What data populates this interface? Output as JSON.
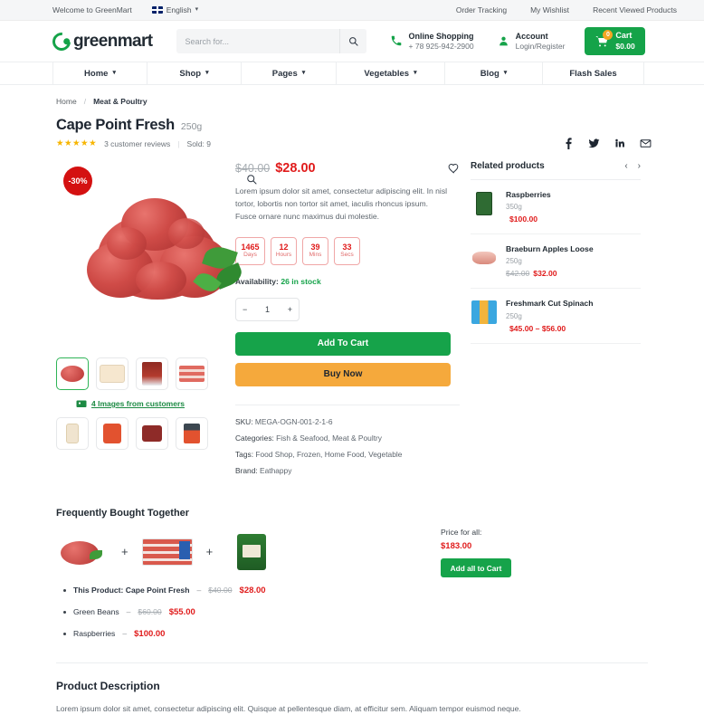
{
  "topbar": {
    "welcome": "Welcome to GreenMart",
    "language": "English",
    "links": [
      "Order Tracking",
      "My Wishlist",
      "Recent Viewed Products"
    ]
  },
  "header": {
    "logo_text": "greenmart",
    "search_placeholder": "Search for...",
    "search_value": "",
    "phone_label": "Online Shopping",
    "phone_number": "+ 78 925-942-2900",
    "account_label": "Account",
    "account_sub": "Login/Register",
    "cart_label": "Cart",
    "cart_total": "$0.00",
    "cart_count": "0"
  },
  "nav": {
    "items": [
      {
        "label": "Home",
        "caret": true
      },
      {
        "label": "Shop",
        "caret": true
      },
      {
        "label": "Pages",
        "caret": true
      },
      {
        "label": "Vegetables",
        "caret": true
      },
      {
        "label": "Blog",
        "caret": true
      },
      {
        "label": "Flash Sales",
        "caret": false
      }
    ]
  },
  "breadcrumb": {
    "home": "Home",
    "separator": "/",
    "current": "Meat & Poultry"
  },
  "product": {
    "title": "Cape Point Fresh",
    "weight": "250g",
    "reviews": "3 customer reviews",
    "sold": "Sold: 9",
    "discount_badge": "-30%",
    "old_price": "$40.00",
    "new_price": "$28.00",
    "description": "Lorem ipsum dolor sit amet, consectetur adipiscing elit. In nisl tortor, lobortis non tortor sit amet, iaculis rhoncus ipsum. Fusce ornare nunc maximus dui molestie.",
    "countdown": [
      {
        "value": "1465",
        "label": "Days"
      },
      {
        "value": "12",
        "label": "Hours"
      },
      {
        "value": "39",
        "label": "Mins"
      },
      {
        "value": "33",
        "label": "Secs"
      }
    ],
    "availability_label": "Availability:",
    "availability_value": "26 in stock",
    "quantity": "1",
    "minus": "−",
    "plus": "+",
    "add_to_cart": "Add To Cart",
    "buy_now": "Buy Now",
    "customer_images_link": "4 Images from customers",
    "meta": {
      "sku_label": "SKU:",
      "sku_value": "MEGA-OGN-001-2-1-6",
      "categories_label": "Categories:",
      "categories_value": "Fish & Seafood, Meat & Poultry",
      "tags_label": "Tags:",
      "tags_value": "Food Shop, Frozen, Home Food, Vegetable",
      "brand_label": "Brand:",
      "brand_value": "Eathappy"
    }
  },
  "share": {
    "icons": [
      "facebook-icon",
      "twitter-icon",
      "linkedin-icon",
      "email-icon"
    ]
  },
  "related": {
    "title": "Related products",
    "prev": "‹",
    "next": "›",
    "items": [
      {
        "name": "Raspberries",
        "weight": "350g",
        "old_price": "",
        "price": "$100.00"
      },
      {
        "name": "Braeburn Apples Loose",
        "weight": "250g",
        "old_price": "$42.00",
        "price": "$32.00"
      },
      {
        "name": "Freshmark Cut Spinach",
        "weight": "250g",
        "old_price": "",
        "price": "$45.00 – $56.00"
      }
    ]
  },
  "fbt": {
    "title": "Frequently Bought Together",
    "plus": "+",
    "price_label": "Price for all:",
    "price_value": "$183.00",
    "button": "Add all to Cart",
    "items": [
      {
        "prefix": "This Product: Cape Point Fresh",
        "dash": "–",
        "old": "$40.00",
        "new": "$28.00"
      },
      {
        "prefix": "Green Beans",
        "dash": "–",
        "old": "$60.00",
        "new": "$55.00"
      },
      {
        "prefix": "Raspberries",
        "dash": "–",
        "old": "",
        "new": "$100.00"
      }
    ]
  },
  "description_section": {
    "title": "Product Description",
    "body": "Lorem ipsum dolor sit amet, consectetur adipiscing elit. Quisque at pellentesque diam, at efficitur sem. Aliquam tempor euismod neque."
  },
  "colors": {
    "brand_green": "#16a34a",
    "accent_orange": "#f5a93c",
    "sale_red": "#e01b1b",
    "badge_red": "#d41111",
    "star_gold": "#f7b500"
  }
}
